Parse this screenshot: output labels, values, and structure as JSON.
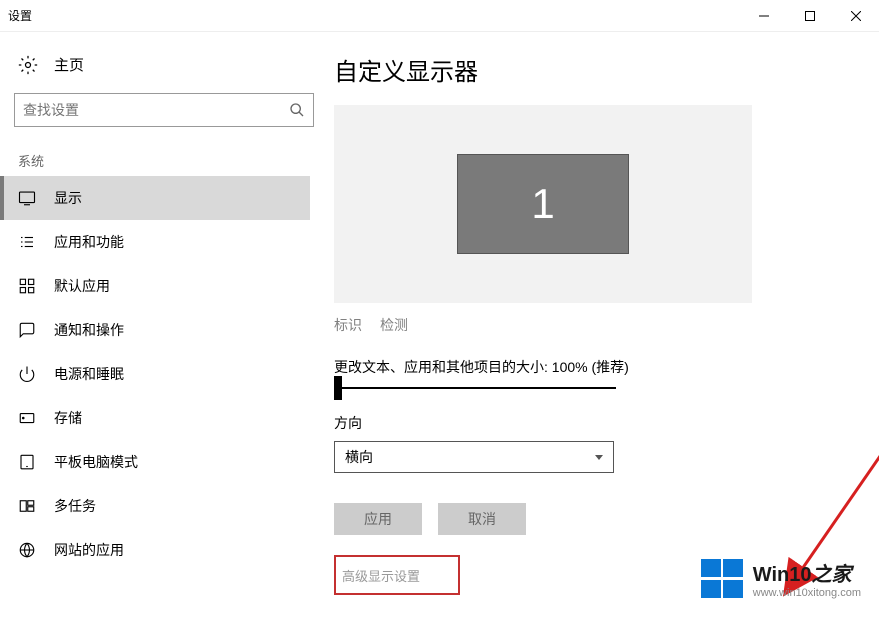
{
  "window": {
    "title": "设置"
  },
  "sidebar": {
    "home": "主页",
    "search_placeholder": "查找设置",
    "section": "系统",
    "items": [
      {
        "label": "显示"
      },
      {
        "label": "应用和功能"
      },
      {
        "label": "默认应用"
      },
      {
        "label": "通知和操作"
      },
      {
        "label": "电源和睡眠"
      },
      {
        "label": "存储"
      },
      {
        "label": "平板电脑模式"
      },
      {
        "label": "多任务"
      },
      {
        "label": "网站的应用"
      }
    ]
  },
  "main": {
    "title": "自定义显示器",
    "monitor_id": "1",
    "identify": "标识",
    "detect": "检测",
    "scale_label": "更改文本、应用和其他项目的大小: 100% (推荐)",
    "orientation_label": "方向",
    "orientation_value": "横向",
    "apply": "应用",
    "cancel": "取消",
    "advanced": "高级显示设置"
  },
  "watermark": {
    "brand_prefix": "Win10",
    "brand_suffix": "之家",
    "url": "www.win10xitong.com"
  }
}
